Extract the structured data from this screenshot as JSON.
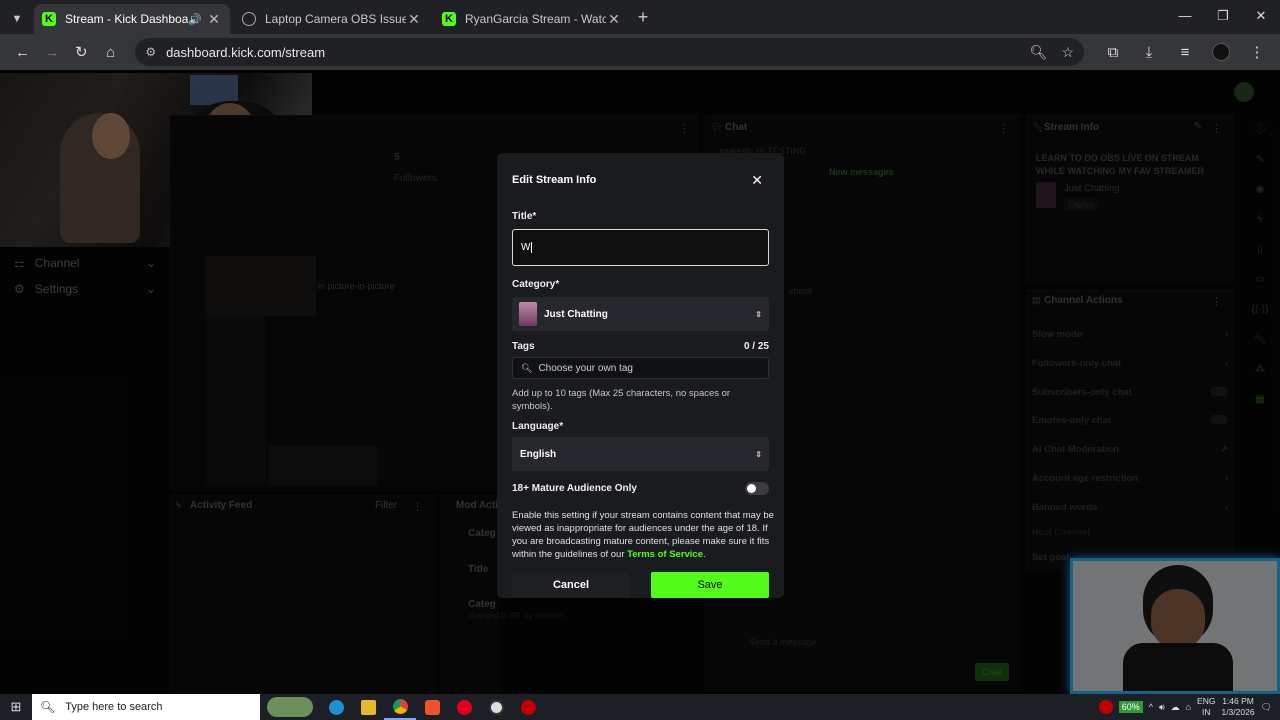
{
  "browser": {
    "tabs": [
      {
        "title": "Stream - Kick Dashboard",
        "active": true,
        "icon": "kick-icon",
        "has_audio": true
      },
      {
        "title": "Laptop Camera OBS Issue",
        "active": false,
        "icon": "globe-icon"
      },
      {
        "title": "RyanGarcia Stream - Watch Live",
        "active": false,
        "icon": "kick-icon"
      }
    ],
    "url": "dashboard.kick.com/stream"
  },
  "dashboard": {
    "sidebar": [
      {
        "label": "Channel",
        "icon": "channel-icon"
      },
      {
        "label": "Settings",
        "icon": "settings-icon"
      }
    ],
    "followers_count": "5",
    "followers_label": "Followers",
    "pip_text": "in picture-in-picture",
    "chat_title": "Chat",
    "chat_first": "snaresh: HI TESTING",
    "chat_new_messages": "New messages",
    "chat_check": "check",
    "chat_placeholder": "Send a message",
    "chat_button": "Chat",
    "stream_info_title": "Stream Info",
    "stream_info_heading": "LEARN TO DO OBS LIVE ON STREAM WHILE WATCHING MY FAV STREAMER",
    "stream_info_category": "Just Chatting",
    "stream_info_language": "English",
    "channel_actions_title": "Channel Actions",
    "channel_actions": [
      "Slow mode",
      "Followers-only chat",
      "Subscribers-only chat",
      "Emotes-only chat",
      "AI Chat Moderation",
      "Account age restriction",
      "Banned words",
      "Host Channel",
      "Set goal"
    ],
    "activity_feed_title": "Activity Feed",
    "activity_feed_filter": "Filter",
    "mod_actions_title": "Mod Acti",
    "mod_items": [
      "Categ",
      "Title",
      "Categ"
    ],
    "mod_footer": "changed to IRL by snaresh"
  },
  "modal": {
    "heading": "Edit Stream Info",
    "title_label": "Title*",
    "title_value": "W",
    "category_label": "Category*",
    "category_value": "Just Chatting",
    "tags_label": "Tags",
    "tags_count": "0 / 25",
    "tags_placeholder": "Choose your own tag",
    "tags_help": "Add up to 10 tags (Max 25 characters, no spaces or symbols).",
    "language_label": "Language*",
    "language_value": "English",
    "mature_label": "18+ Mature Audience Only",
    "mature_enabled": false,
    "mature_help": "Enable this setting if your stream contains content that may be viewed as inappropriate for audiences under the age of 18. If you are broadcasting mature content, please make sure it fits within the guidelines of our",
    "tos_link": "Terms of Service",
    "cancel_label": "Cancel",
    "save_label": "Save",
    "accent_color": "#53fc18"
  },
  "taskbar": {
    "search_placeholder": "Type here to search",
    "battery": "60%",
    "language": "ENG",
    "region": "IN",
    "time": "1:46 PM",
    "date": "1/3/2026"
  }
}
